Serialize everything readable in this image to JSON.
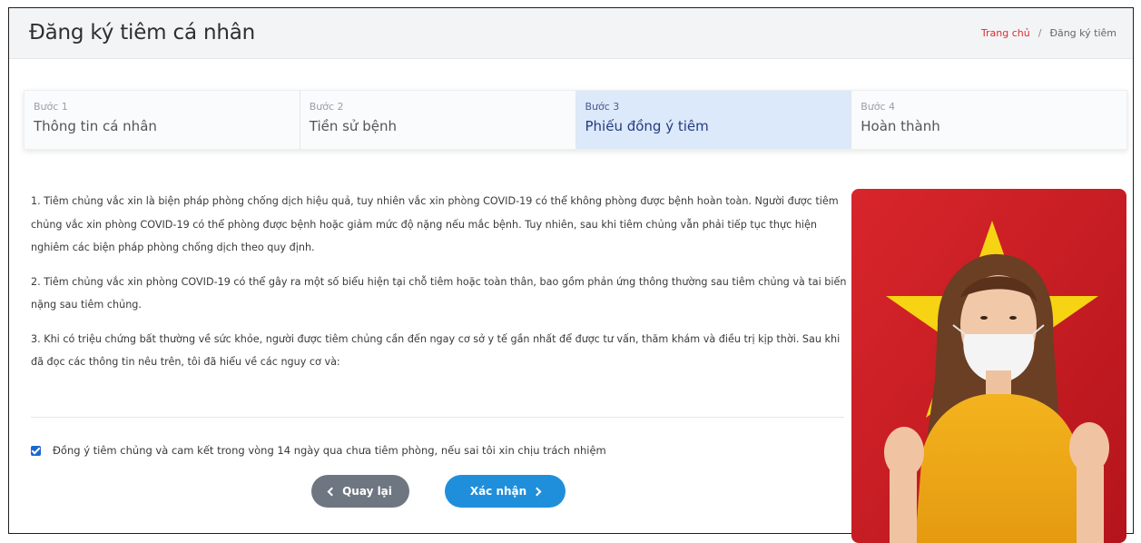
{
  "header": {
    "title": "Đăng ký tiêm cá nhân",
    "breadcrumb": {
      "home": "Trang chủ",
      "separator": "/",
      "current": "Đăng ký tiêm"
    }
  },
  "steps": [
    {
      "num": "Bước 1",
      "name": "Thông tin cá nhân",
      "active": false
    },
    {
      "num": "Bước 2",
      "name": "Tiền sử bệnh",
      "active": false
    },
    {
      "num": "Bước 3",
      "name": "Phiếu đồng ý tiêm",
      "active": true
    },
    {
      "num": "Bước 4",
      "name": "Hoàn thành",
      "active": false
    }
  ],
  "content": {
    "p1": "1. Tiêm chủng vắc xin là biện pháp phòng chống dịch hiệu quả, tuy nhiên vắc xin phòng COVID-19 có thể không phòng được bệnh hoàn toàn. Người được tiêm chủng vắc xin phòng COVID-19 có thể phòng được bệnh hoặc giảm mức độ nặng nếu mắc bệnh. Tuy nhiên, sau khi tiêm chủng vẫn phải tiếp tục thực hiện nghiêm các biện pháp phòng chống dịch theo quy định.",
    "p2": "2. Tiêm chủng vắc xin phòng COVID-19 có thể gây ra một số biểu hiện tại chỗ tiêm hoặc toàn thân, bao gồm phản ứng thông thường sau tiêm chủng và tai biến nặng sau tiêm chủng.",
    "p3": "3. Khi có triệu chứng bất thường về sức khỏe, người được tiêm chủng cần đến ngay cơ sở y tế gần nhất để được tư vấn, thăm khám và điều trị kịp thời. Sau khi đã đọc các thông tin nêu trên, tôi đã hiểu về các nguy cơ và:"
  },
  "consent": {
    "checked": true,
    "label": "Đồng ý tiêm chủng và cam kết trong vòng 14 ngày qua chưa tiêm phòng, nếu sai tôi xin chịu trách nhiệm"
  },
  "buttons": {
    "back": "Quay lại",
    "confirm": "Xác nhận"
  },
  "colors": {
    "accent": "#1f8fdc",
    "active_step_bg": "#dbe9fb",
    "breadcrumb_home": "#e02b2b",
    "back_button": "#6e7681"
  }
}
